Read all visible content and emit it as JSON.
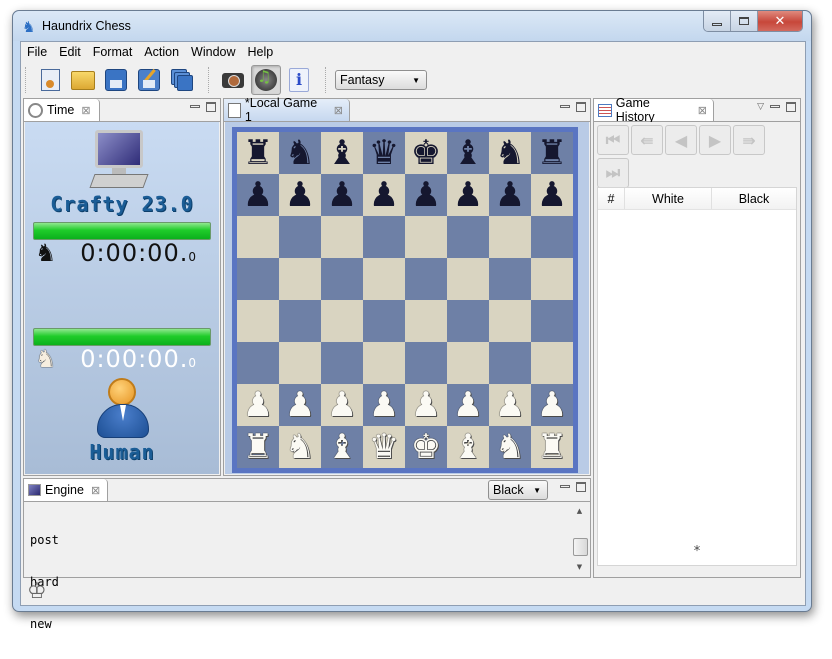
{
  "window": {
    "title": "Haundrix Chess",
    "app_icon": "knight-icon",
    "controls": {
      "minimize": "minimize-icon",
      "maximize": "maximize-icon",
      "close": "close-icon"
    }
  },
  "menubar": {
    "items": [
      "File",
      "Edit",
      "Format",
      "Action",
      "Window",
      "Help"
    ]
  },
  "toolbar": {
    "buttons": [
      {
        "name": "new-game",
        "icon": "new-document-icon"
      },
      {
        "name": "open",
        "icon": "folder-icon"
      },
      {
        "name": "save",
        "icon": "floppy-disk-icon"
      },
      {
        "name": "save-as",
        "icon": "floppy-edit-icon"
      },
      {
        "name": "save-all",
        "icon": "floppy-stack-icon"
      },
      {
        "name": "screenshot",
        "icon": "camera-icon"
      },
      {
        "name": "sound",
        "icon": "music-speaker-icon",
        "pressed": true
      },
      {
        "name": "about",
        "icon": "info-icon"
      }
    ],
    "theme_select": {
      "value": "Fantasy"
    }
  },
  "time_panel": {
    "tab_label": "Time",
    "top_player": {
      "name": "Crafty 23.0",
      "type": "computer",
      "color": "black",
      "clock_main": "0:00:00.",
      "clock_tenths": "0",
      "time_remaining_fraction": 1.0
    },
    "bottom_player": {
      "name": "Human",
      "type": "human",
      "color": "white",
      "clock_main": "0:00:00.",
      "clock_tenths": "0",
      "time_remaining_fraction": 1.0
    }
  },
  "board_panel": {
    "tab_label": "*Local Game 1",
    "colors": {
      "light": "#d9d4c1",
      "dark": "#6e80a6",
      "frame": "#5a75c2"
    },
    "position": [
      [
        "br",
        "bn",
        "bb",
        "bq",
        "bk",
        "bb",
        "bn",
        "br"
      ],
      [
        "bp",
        "bp",
        "bp",
        "bp",
        "bp",
        "bp",
        "bp",
        "bp"
      ],
      [
        "",
        "",
        "",
        "",
        "",
        "",
        "",
        ""
      ],
      [
        "",
        "",
        "",
        "",
        "",
        "",
        "",
        ""
      ],
      [
        "",
        "",
        "",
        "",
        "",
        "",
        "",
        ""
      ],
      [
        "",
        "",
        "",
        "",
        "",
        "",
        "",
        ""
      ],
      [
        "wp",
        "wp",
        "wp",
        "wp",
        "wp",
        "wp",
        "wp",
        "wp"
      ],
      [
        "wr",
        "wn",
        "wb",
        "wq",
        "wk",
        "wb",
        "wn",
        "wr"
      ]
    ]
  },
  "history_panel": {
    "tab_label": "Game History",
    "nav_buttons": [
      "first-move",
      "back-fast",
      "back",
      "forward",
      "forward-fast",
      "last-move"
    ],
    "columns": [
      "#",
      "White",
      "Black"
    ],
    "rows": [],
    "footer_marker": "*"
  },
  "engine_panel": {
    "tab_label": "Engine",
    "side_select": {
      "value": "Black"
    },
    "log": [
      "post",
      "hard",
      "new"
    ]
  },
  "statusbar": {
    "icon": "crown-icon"
  }
}
